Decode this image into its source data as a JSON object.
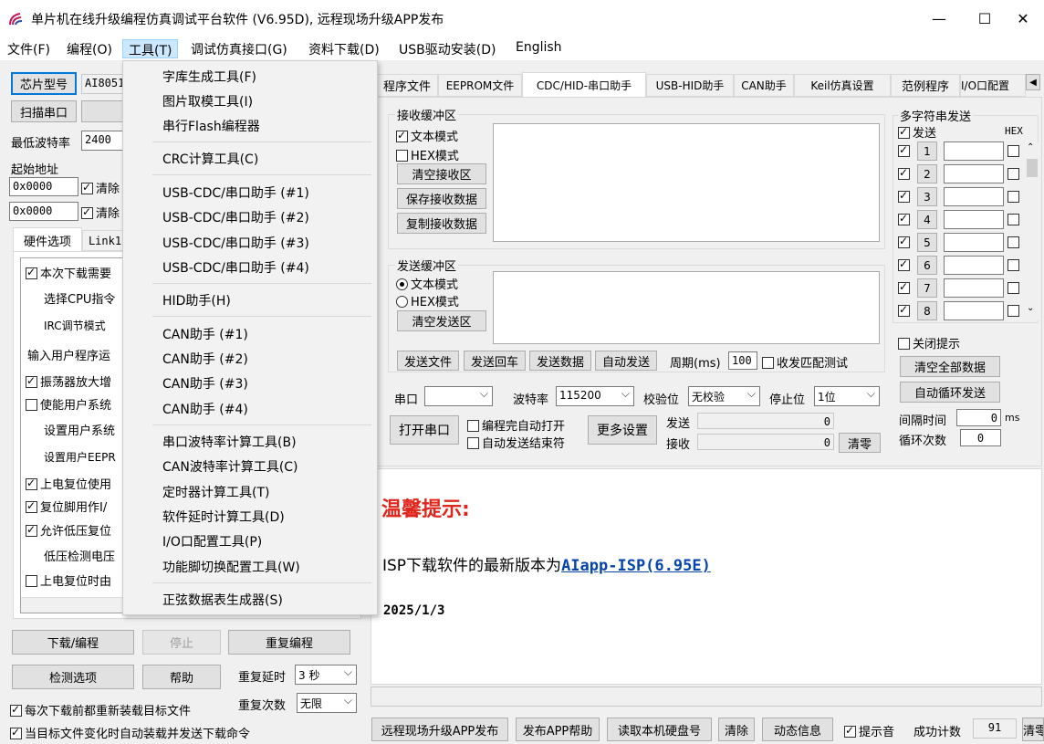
{
  "window": {
    "title": "单片机在线升级编程仿真调试平台软件 (V6.95D), 远程现场升级APP发布",
    "minimize": "—",
    "maximize": "☐",
    "close": "✕"
  },
  "menubar": [
    {
      "label": "文件(F)"
    },
    {
      "label": "编程(O)"
    },
    {
      "label": "工具(T)"
    },
    {
      "label": "调试仿真接口(G)"
    },
    {
      "label": "资料下载(D)"
    },
    {
      "label": "USB驱动安装(D)"
    },
    {
      "label": "English"
    }
  ],
  "tools_menu": [
    "字库生成工具(F)",
    "图片取模工具(I)",
    "串行Flash编程器",
    "CRC计算工具(C)",
    "USB-CDC/串口助手 (#1)",
    "USB-CDC/串口助手 (#2)",
    "USB-CDC/串口助手 (#3)",
    "USB-CDC/串口助手 (#4)",
    "HID助手(H)",
    "CAN助手 (#1)",
    "CAN助手 (#2)",
    "CAN助手 (#3)",
    "CAN助手 (#4)",
    "串口波特率计算工具(B)",
    "CAN波特率计算工具(C)",
    "定时器计算工具(T)",
    "软件延时计算工具(D)",
    "I/O口配置工具(P)",
    "功能脚切换配置工具(W)",
    "正弦数据表生成器(S)"
  ],
  "left": {
    "chip_btn": "芯片型号",
    "chip_value": "AI8051",
    "scan_btn": "扫描串口",
    "min_baud_label": "最低波特率",
    "min_baud_value": "2400",
    "start_addr_label": "起始地址",
    "addr1": "0x0000",
    "addr2": "0x0000",
    "clear1": "清除",
    "clear2": "清除",
    "tabs": [
      "硬件选项",
      "Link1"
    ],
    "options": [
      "本次下载需要",
      "选择CPU指令",
      "IRC调节模式",
      "输入用户程序运",
      "振荡器放大增",
      "使能用户系统",
      "设置用户系统",
      "设置用户EEPR",
      "上电复位使用",
      "复位脚用作I/",
      "允许低压复位",
      "低压检测电压",
      "上电复位时由"
    ],
    "download_btn": "下载/编程",
    "stop_btn": "停止",
    "reprogram_btn": "重复编程",
    "check_btn": "检测选项",
    "help_btn": "帮助",
    "repeat_delay_label": "重复延时",
    "repeat_delay_value": "3 秒",
    "repeat_count_label": "重复次数",
    "repeat_count_value": "无限",
    "reload_label": "每次下载前都重新装载目标文件",
    "auto_reload_label": "当目标文件变化时自动装载并发送下载命令"
  },
  "tabs": [
    "程序文件",
    "EEPROM文件",
    "CDC/HID-串口助手",
    "USB-HID助手",
    "CAN助手",
    "Keil仿真设置",
    "范例程序",
    "I/O口配置"
  ],
  "recv": {
    "title": "接收缓冲区",
    "text_mode": "文本模式",
    "hex_mode": "HEX模式",
    "clear_btn": "清空接收区",
    "save_btn": "保存接收数据",
    "copy_btn": "复制接收数据"
  },
  "send": {
    "title": "发送缓冲区",
    "text_mode": "文本模式",
    "hex_mode": "HEX模式",
    "clear_btn": "清空发送区",
    "send_file_btn": "发送文件",
    "send_enter_btn": "发送回车",
    "send_data_btn": "发送数据",
    "auto_send_btn": "自动发送",
    "period_label": "周期(ms)",
    "period_value": "100",
    "match_label": "收发匹配测试"
  },
  "serial": {
    "port_label": "串口",
    "port_value": "",
    "baud_label": "波特率",
    "baud_value": "115200",
    "parity_label": "校验位",
    "parity_value": "无校验",
    "stop_label": "停止位",
    "stop_value": "1位",
    "open_btn": "打开串口",
    "auto_open_label": "编程完自动打开",
    "auto_send_end_label": "自动发送结束符",
    "more_btn": "更多设置",
    "send_label": "发送",
    "send_count": "0",
    "recv_label": "接收",
    "recv_count": "0",
    "clear_btn": "清零"
  },
  "multi": {
    "title": "多字符串发送",
    "send_label": "发送",
    "hex_label": "HEX",
    "rows": [
      "1",
      "2",
      "3",
      "4",
      "5",
      "6",
      "7",
      "8"
    ],
    "close_tip_label": "关闭提示",
    "clear_all_btn": "清空全部数据",
    "auto_loop_btn": "自动循环发送",
    "interval_label": "间隔时间",
    "interval_value": "0",
    "interval_unit": "ms",
    "loop_count_label": "循环次数",
    "loop_count_value": "0"
  },
  "notice": {
    "heading": "温馨提示:",
    "line_prefix": "ISP下载软件的最新版本为",
    "link": "AIapp-ISP(6.95E)",
    "date": "2025/1/3"
  },
  "bottom": {
    "remote_btn": "远程现场升级APP发布",
    "app_help_btn": "发布APP帮助",
    "read_disk_btn": "读取本机硬盘号",
    "clear_btn": "清除",
    "dyn_info_btn": "动态信息",
    "sound_label": "提示音",
    "success_label": "成功计数",
    "success_value": "91",
    "clear_short": "清零"
  }
}
